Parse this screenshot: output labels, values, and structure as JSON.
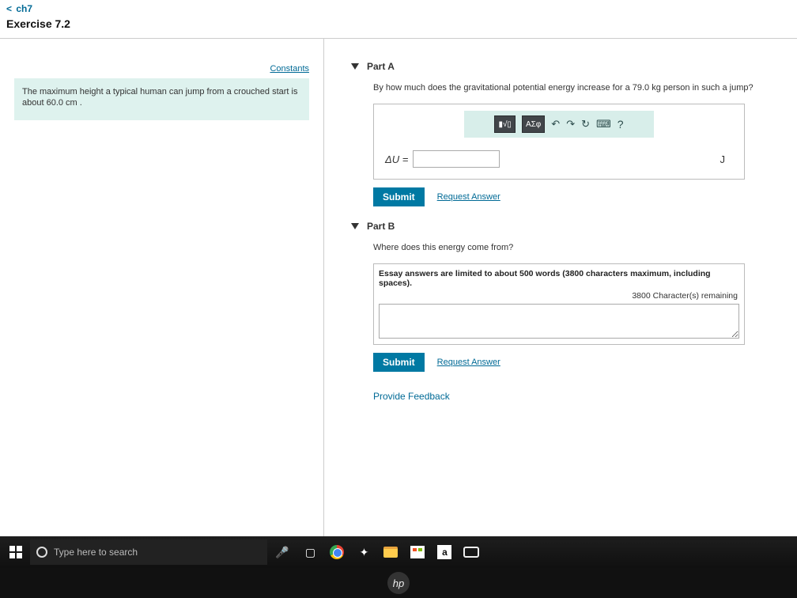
{
  "nav": {
    "back_label": "ch7"
  },
  "exercise": {
    "title": "Exercise 7.2"
  },
  "left": {
    "constants_label": "Constants",
    "problem_text": "The maximum height a typical human can jump from a crouched start is about 60.0 cm ."
  },
  "partA": {
    "title": "Part A",
    "question": "By how much does the gravitational potential energy increase for a 79.0 kg person in such a jump?",
    "toolbar": {
      "templates_label": "▮√▯",
      "symbols_label": "ΑΣφ",
      "undo": "↶",
      "redo": "↷",
      "reset": "↻",
      "keyboard": "⌨",
      "help": "?"
    },
    "var_label": "ΔU =",
    "unit": "J",
    "submit_label": "Submit",
    "request_label": "Request Answer"
  },
  "partB": {
    "title": "Part B",
    "question": "Where does this energy come from?",
    "essay_note": "Essay answers are limited to about 500 words (3800 characters maximum, including spaces).",
    "remaining": "3800 Character(s) remaining",
    "submit_label": "Submit",
    "request_label": "Request Answer"
  },
  "feedback_label": "Provide Feedback",
  "taskbar": {
    "search_placeholder": "Type here to search",
    "amazon": "a"
  },
  "hp": "hp"
}
